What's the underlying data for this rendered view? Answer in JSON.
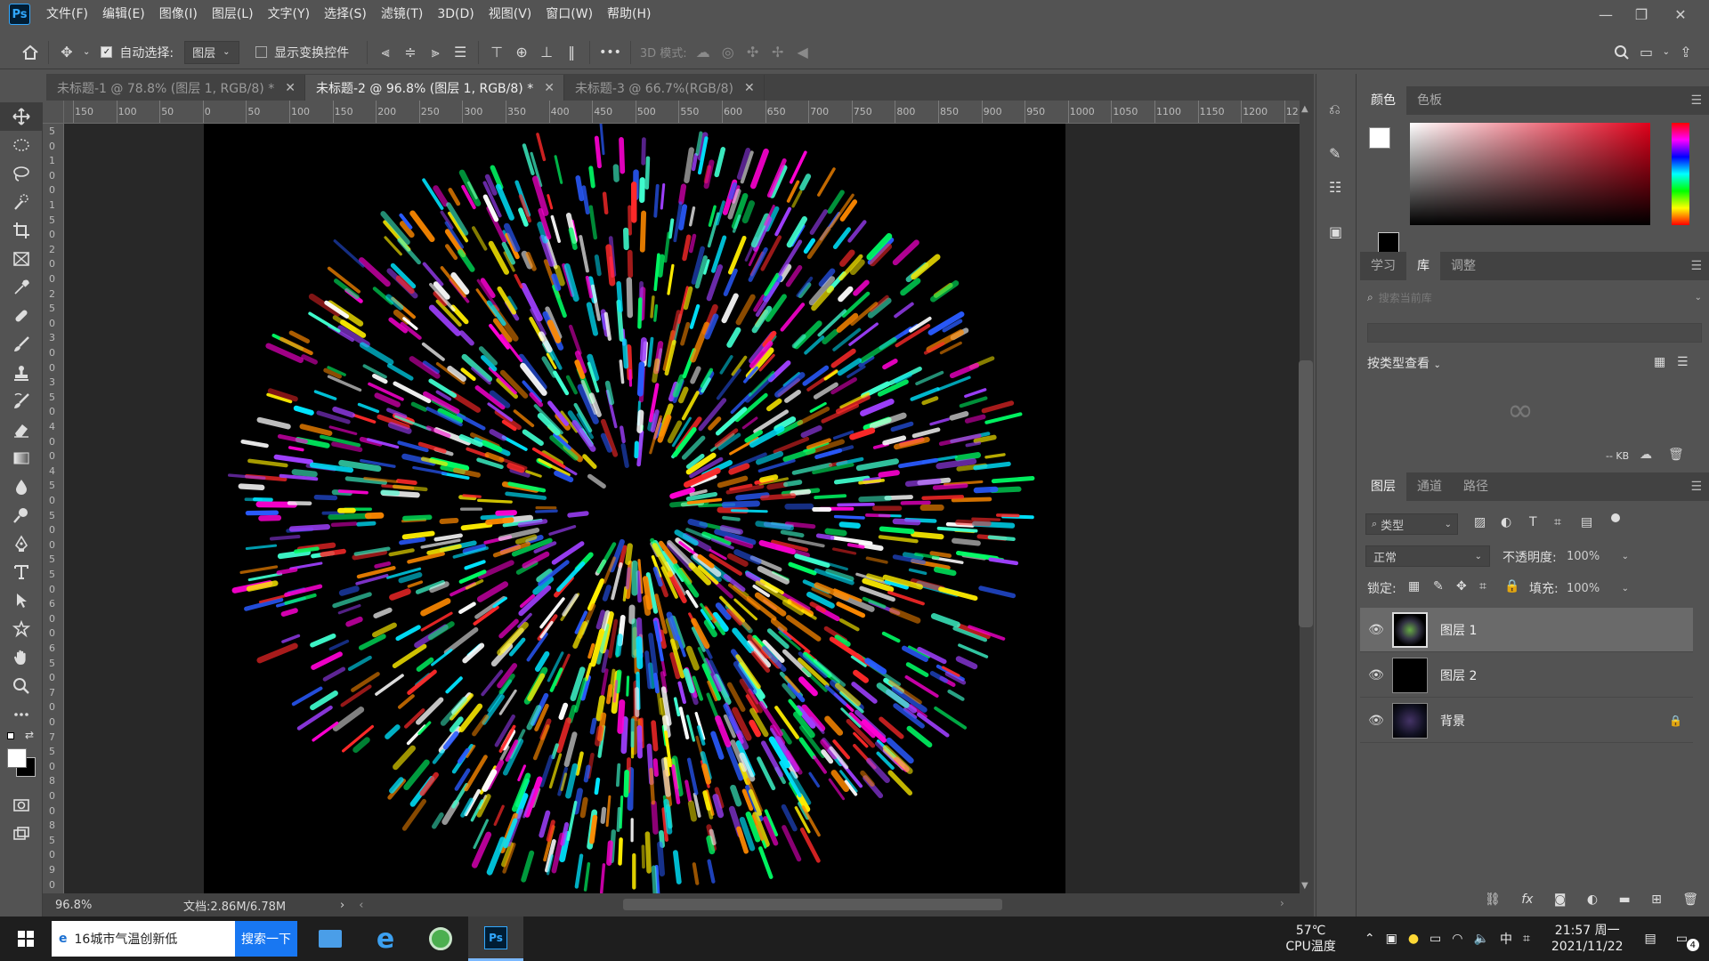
{
  "app": {
    "logo": "Ps",
    "menus": [
      "文件(F)",
      "编辑(E)",
      "图像(I)",
      "图层(L)",
      "文字(Y)",
      "选择(S)",
      "滤镜(T)",
      "3D(D)",
      "视图(V)",
      "窗口(W)",
      "帮助(H)"
    ]
  },
  "options": {
    "auto_select_label": "自动选择:",
    "auto_select_value": "图层",
    "show_transform_label": "显示变换控件",
    "mode_3d_label": "3D 模式:",
    "more": "•••"
  },
  "tabs": [
    {
      "label": "未标题-1 @ 78.8% (图层 1, RGB/8) *",
      "close": "✕"
    },
    {
      "label": "未标题-2 @ 96.8% (图层 1, RGB/8) *",
      "close": "✕"
    },
    {
      "label": "未标题-3 @ 66.7%(RGB/8)",
      "close": "✕"
    }
  ],
  "ruler_h": [
    "150",
    "100",
    "50",
    "0",
    "50",
    "100",
    "150",
    "200",
    "250",
    "300",
    "350",
    "400",
    "450",
    "500",
    "550",
    "600",
    "650",
    "700",
    "750",
    "800",
    "850",
    "900",
    "950",
    "1000",
    "1050",
    "1100",
    "1150",
    "1200",
    "12"
  ],
  "ruler_v": [
    "5",
    "0",
    "1",
    "0",
    "0",
    "1",
    "5",
    "0",
    "2",
    "0",
    "0",
    "2",
    "5",
    "0",
    "3",
    "0",
    "0",
    "3",
    "5",
    "0",
    "4",
    "0",
    "0",
    "4",
    "5",
    "0",
    "5",
    "0",
    "0",
    "5",
    "5",
    "0",
    "6",
    "0",
    "0",
    "6",
    "5",
    "0",
    "7",
    "0",
    "0",
    "7",
    "5",
    "0",
    "8",
    "0",
    "0",
    "8",
    "5",
    "0",
    "9",
    "0"
  ],
  "status": {
    "zoom": "96.8%",
    "doc": "文档:2.86M/6.78M",
    "arrow": "›"
  },
  "color_panel": {
    "tabs": [
      "颜色",
      "色板"
    ],
    "fg": "#ffffff",
    "bg": "#000000"
  },
  "library_panel": {
    "tabs": [
      "学习",
      "库",
      "调整"
    ],
    "search_placeholder": "搜索当前库",
    "view_by": "按类型查看",
    "size": "-- KB"
  },
  "layers_panel": {
    "tabs": [
      "图层",
      "通道",
      "路径"
    ],
    "filter": "类型",
    "blend": "正常",
    "opacity_label": "不透明度:",
    "opacity": "100%",
    "lock_label": "锁定:",
    "fill_label": "填充:",
    "fill": "100%",
    "layers": [
      {
        "name": "图层 1",
        "selected": true
      },
      {
        "name": "图层 2",
        "selected": false
      },
      {
        "name": "背景",
        "selected": false,
        "locked": true
      }
    ]
  },
  "taskbar": {
    "search_text": "16城市气温创新低",
    "search_button": "搜索一下",
    "temp": "57℃",
    "temp_label": "CPU温度",
    "ime": "中",
    "time": "21:57 周一",
    "date": "2021/11/22",
    "notif_count": "4"
  }
}
